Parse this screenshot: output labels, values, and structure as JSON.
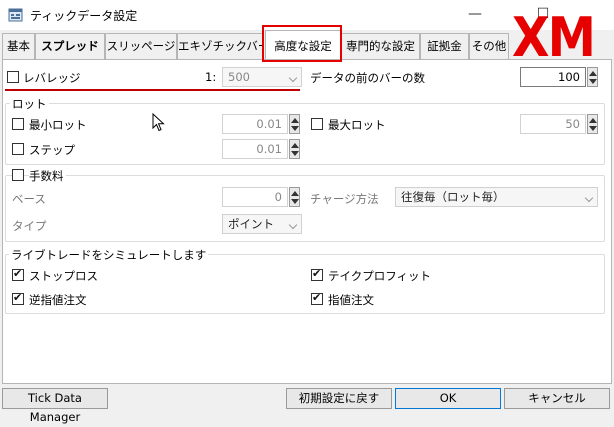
{
  "window": {
    "title": "ティックデータ設定"
  },
  "tabs": [
    {
      "label": "基本"
    },
    {
      "label": "スプレッド"
    },
    {
      "label": "スリッページ"
    },
    {
      "label": "エキゾチックバー"
    },
    {
      "label": "高度な設定"
    },
    {
      "label": "専門的な設定"
    },
    {
      "label": "証拠金"
    },
    {
      "label": "その他"
    }
  ],
  "overlay_text": "XM",
  "leverage": {
    "label": "レバレッジ",
    "prefix": "1:",
    "value": "500",
    "checked": false
  },
  "prev_bars": {
    "label": "データの前のバーの数",
    "value": "100"
  },
  "lot": {
    "group_label": "ロット",
    "min_lot": {
      "label": "最小ロット",
      "value": "0.01"
    },
    "max_lot": {
      "label": "最大ロット",
      "value": "50"
    },
    "step": {
      "label": "ステップ",
      "value": "0.01"
    }
  },
  "commission": {
    "group_label": "手数料",
    "base": {
      "label": "ベース",
      "value": "0"
    },
    "charge_method": {
      "label": "チャージ方法",
      "value": "往復毎（ロット毎）"
    },
    "type": {
      "label": "タイプ",
      "value": "ポイント"
    }
  },
  "simulate": {
    "group_label": "ライブトレードをシミュレートします",
    "stop_loss": {
      "label": "ストップロス",
      "checked": true
    },
    "take_profit": {
      "label": "テイクプロフィット",
      "checked": true
    },
    "stop_order": {
      "label": "逆指値注文",
      "checked": true
    },
    "limit_order": {
      "label": "指値注文",
      "checked": true
    }
  },
  "footer": {
    "tdm_label": "Tick Data Manager",
    "reset_label": "初期設定に戻す",
    "ok_label": "OK",
    "cancel_label": "キャンセル"
  },
  "colors": {
    "highlight": "#e60000",
    "accent": "#0078d7"
  }
}
